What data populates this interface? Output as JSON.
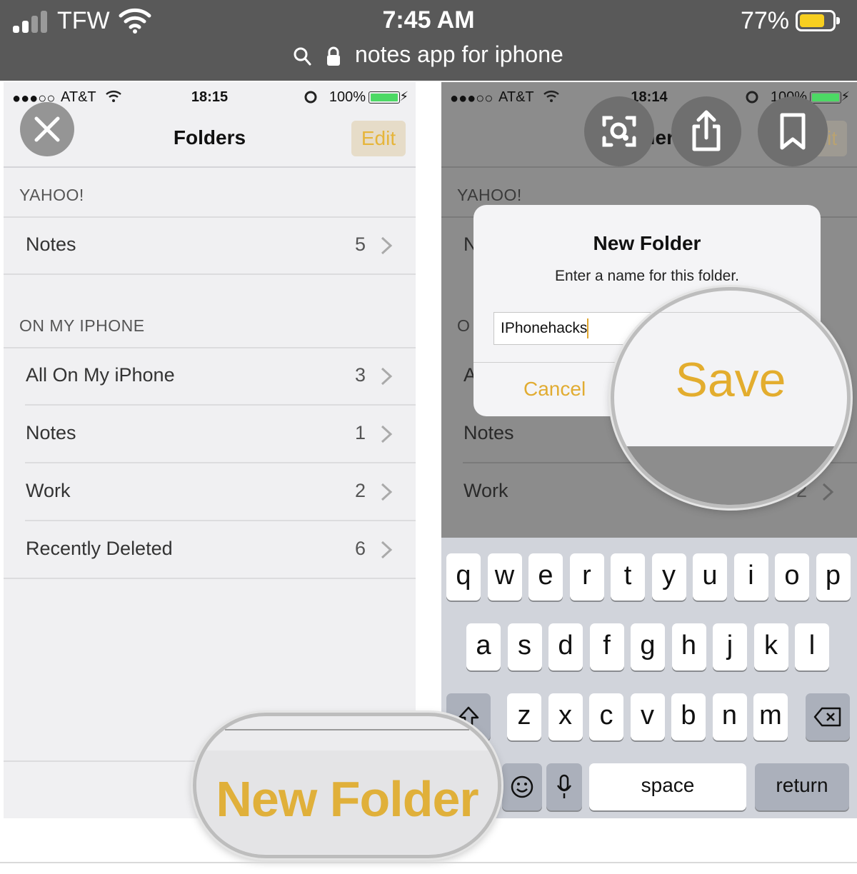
{
  "outer_status": {
    "carrier": "TFW",
    "time": "7:45 AM",
    "battery": "77%",
    "battery_level": 0.77,
    "url": "notes app for iphone"
  },
  "left": {
    "status": {
      "carrier": "AT&T",
      "time": "18:15",
      "battery": "100%"
    },
    "nav": {
      "title": "Folders",
      "edit": "Edit"
    },
    "sections": [
      {
        "header": "YAHOO!",
        "rows": [
          {
            "label": "Notes",
            "count": "5"
          }
        ]
      },
      {
        "header": "ON MY IPHONE",
        "rows": [
          {
            "label": "All On My iPhone",
            "count": "3"
          },
          {
            "label": "Notes",
            "count": "1"
          },
          {
            "label": "Work",
            "count": "2"
          },
          {
            "label": "Recently Deleted",
            "count": "6"
          }
        ]
      }
    ],
    "magnified": "New Folder"
  },
  "right": {
    "status": {
      "carrier": "AT&T",
      "time": "18:14",
      "battery": "100%"
    },
    "nav": {
      "title": "Folders",
      "edit": "Edit"
    },
    "section_yahoo": "YAHOO!",
    "partial_row_1": "N",
    "partial_section": "O",
    "partial_row_2": "A",
    "row_notes": "Notes",
    "row_work": "Work",
    "row_work_count": "2",
    "dialog": {
      "title": "New Folder",
      "message": "Enter a name for this folder.",
      "input_value": "IPhonehacks",
      "cancel": "Cancel",
      "save": "Save"
    },
    "keyboard": {
      "row1": [
        "q",
        "w",
        "e",
        "r",
        "t",
        "y",
        "u",
        "i",
        "o",
        "p"
      ],
      "row2": [
        "a",
        "s",
        "d",
        "f",
        "g",
        "h",
        "j",
        "k",
        "l"
      ],
      "row3": [
        "z",
        "x",
        "c",
        "v",
        "b",
        "n",
        "m"
      ],
      "space": "space",
      "return": "return"
    }
  },
  "colors": {
    "accent": "#e3ad2e",
    "outer_bar": "#595959",
    "battery_yellow": "#f7cf1f"
  }
}
